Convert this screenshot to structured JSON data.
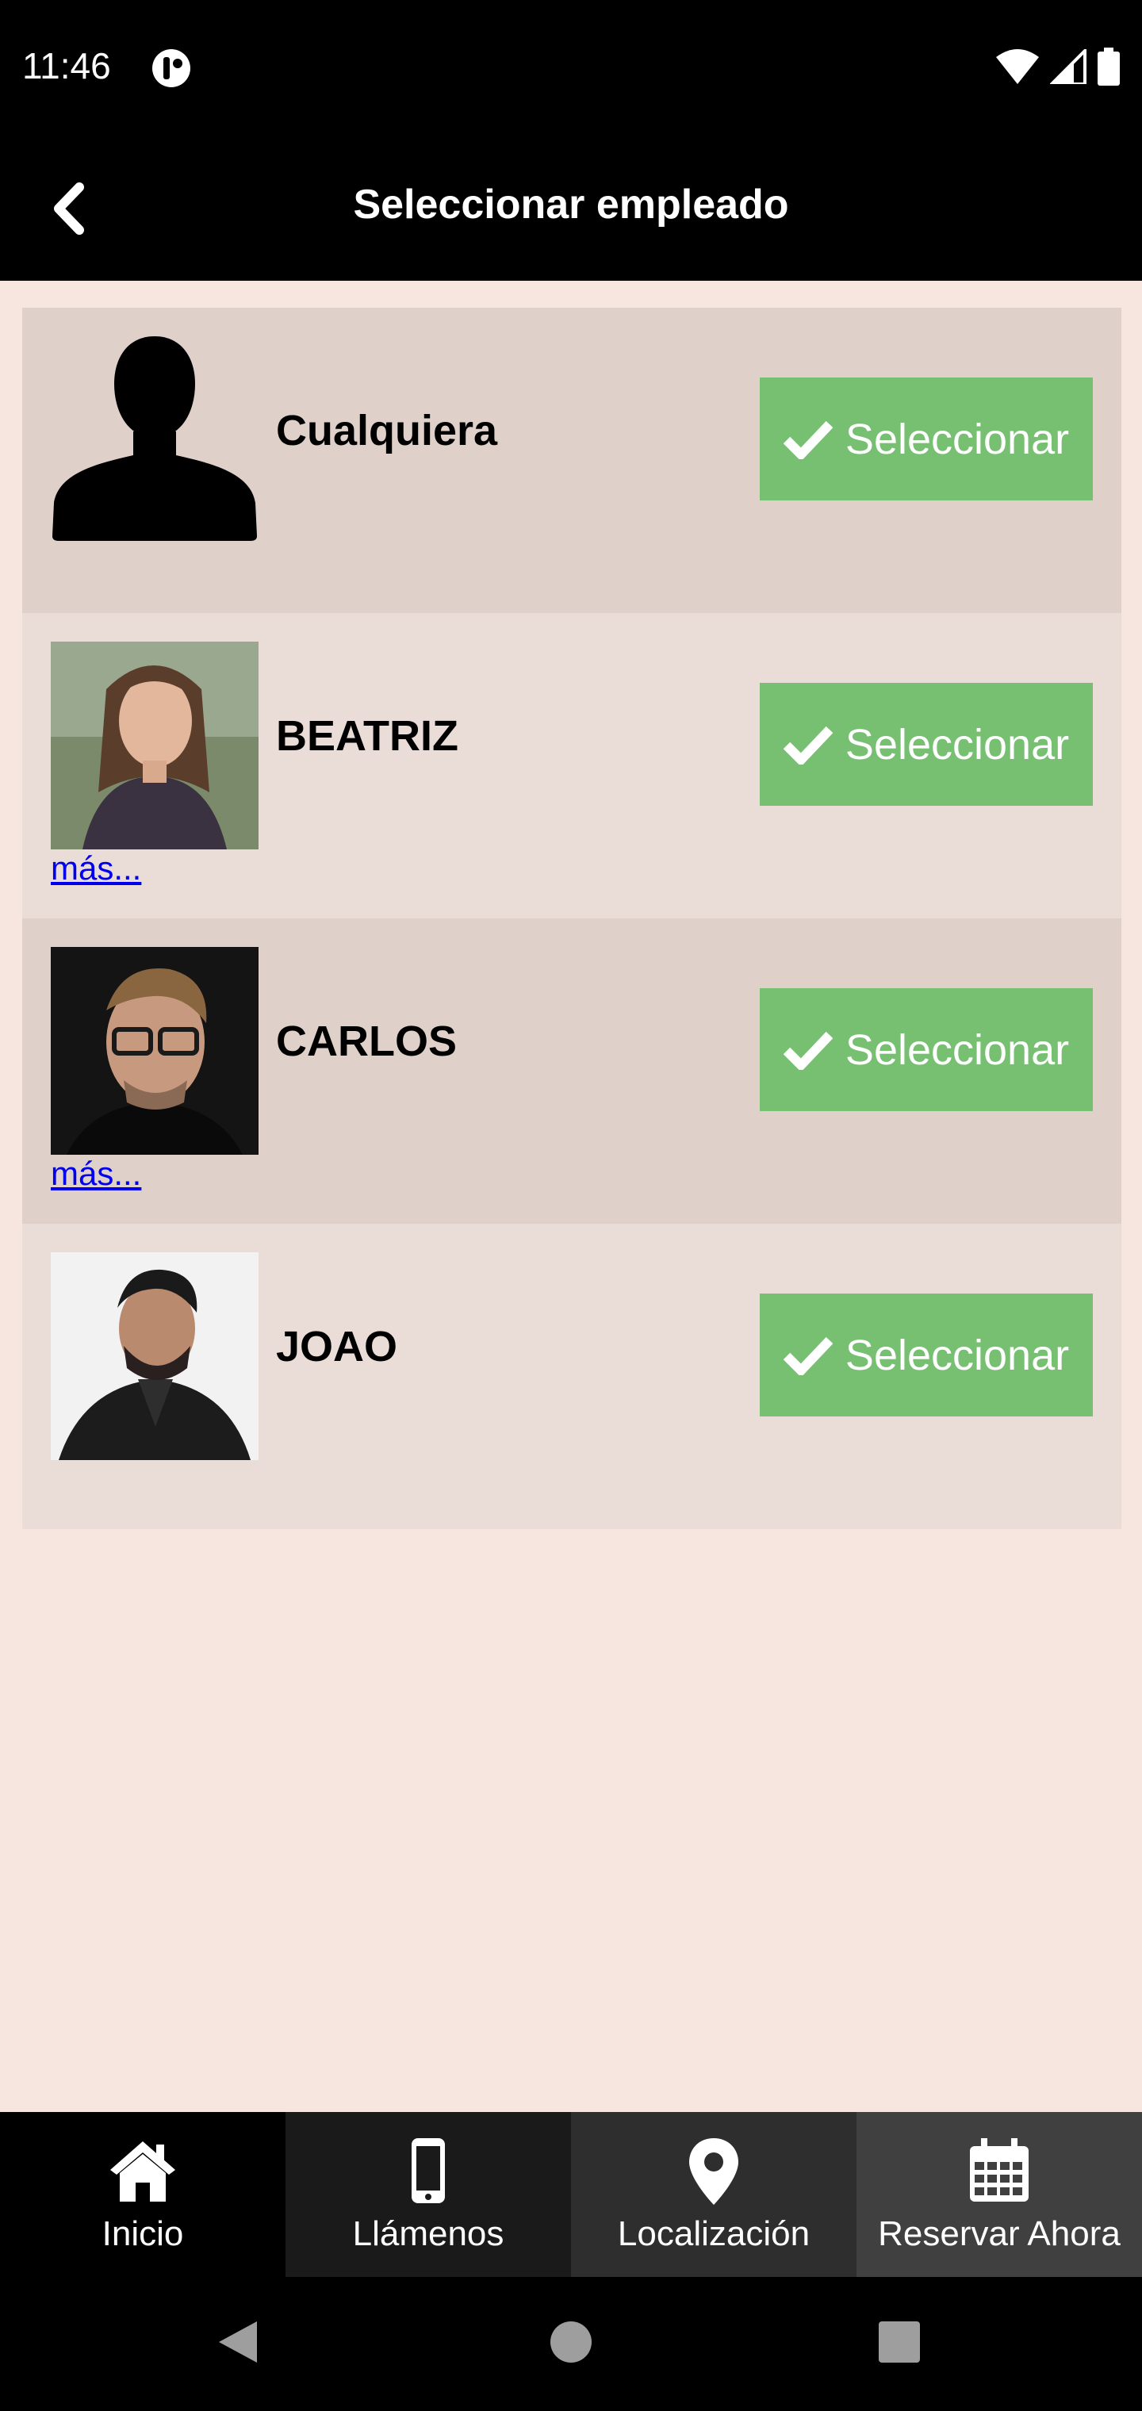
{
  "status_bar": {
    "time": "11:46"
  },
  "app_bar": {
    "title": "Seleccionar empleado"
  },
  "employees": [
    {
      "name": "Cualquiera",
      "button_label": "Seleccionar",
      "more_label": ""
    },
    {
      "name": "BEATRIZ",
      "button_label": "Seleccionar",
      "more_label": "más..."
    },
    {
      "name": "CARLOS",
      "button_label": "Seleccionar",
      "more_label": "más..."
    },
    {
      "name": "JOAO",
      "button_label": "Seleccionar",
      "more_label": ""
    }
  ],
  "bottom_nav": {
    "items": [
      {
        "label": "Inicio",
        "icon": "home-icon"
      },
      {
        "label": "Llámenos",
        "icon": "phone-icon"
      },
      {
        "label": "Localización",
        "icon": "location-pin-icon"
      },
      {
        "label": "Reservar Ahora",
        "icon": "calendar-icon"
      }
    ]
  },
  "colors": {
    "background": "#f6e6df",
    "row_dark": "#dfd1ca",
    "row_light": "#eaddd7",
    "select_button": "#77c072",
    "link": "#0000ee"
  }
}
